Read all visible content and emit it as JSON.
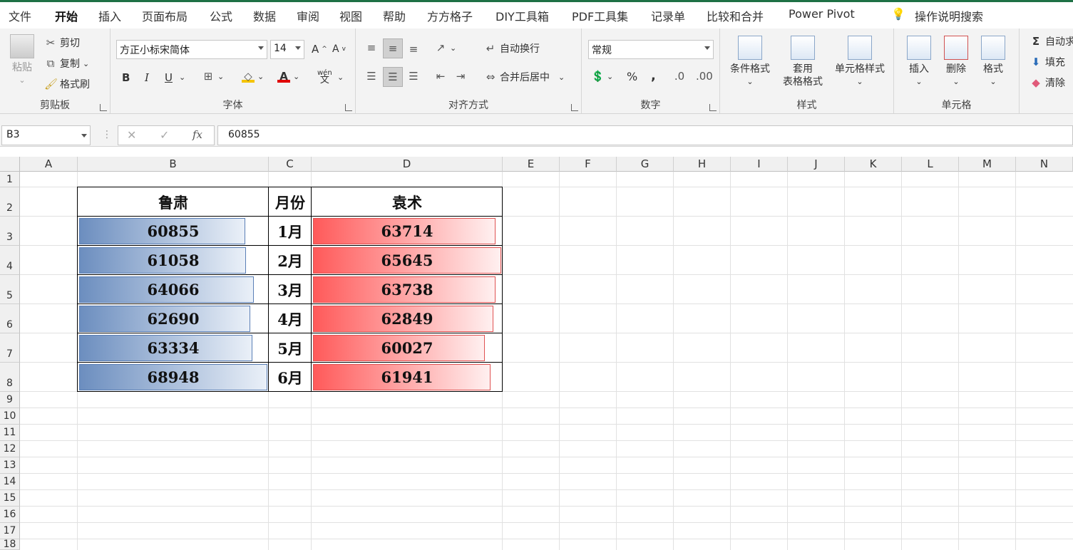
{
  "tabs": [
    "文件",
    "开始",
    "插入",
    "页面布局",
    "公式",
    "数据",
    "审阅",
    "视图",
    "帮助",
    "方方格子",
    "DIY工具箱",
    "PDF工具集",
    "记录单",
    "比较和合并",
    "Power Pivot"
  ],
  "active_tab": "开始",
  "search_placeholder": "操作说明搜索",
  "clipboard": {
    "paste": "粘贴",
    "cut": "剪切",
    "copy": "复制",
    "format_painter": "格式刷",
    "label": "剪贴板"
  },
  "font": {
    "name": "方正小标宋简体",
    "size": "14",
    "bold": "B",
    "italic": "I",
    "underline": "U",
    "label": "字体",
    "phonetic": "wén"
  },
  "alignment": {
    "wrap": "自动换行",
    "merge": "合并后居中",
    "label": "对齐方式"
  },
  "number": {
    "format": "常规",
    "percent": "%",
    "comma": ",",
    "label": "数字"
  },
  "styles": {
    "conditional": "条件格式",
    "table_line1": "套用",
    "table_line2": "表格格式",
    "cell_styles": "单元格样式",
    "label": "样式"
  },
  "cells": {
    "insert": "插入",
    "delete": "删除",
    "format": "格式",
    "label": "单元格"
  },
  "editing": {
    "autosum": "自动求",
    "fill": "填充",
    "clear": "清除"
  },
  "formula_bar": {
    "name_box": "B3",
    "formula": "60855",
    "fx": "fx"
  },
  "columns": [
    "A",
    "B",
    "C",
    "D",
    "E",
    "F",
    "G",
    "H",
    "I",
    "J",
    "K",
    "L",
    "M",
    "N"
  ],
  "rows": [
    "1",
    "2",
    "3",
    "4",
    "5",
    "6",
    "7",
    "8",
    "9",
    "10",
    "11",
    "12",
    "13",
    "14",
    "15",
    "16",
    "17",
    "18"
  ],
  "table": {
    "headers": [
      "鲁肃",
      "月份",
      "袁术"
    ],
    "rows": [
      {
        "b": "60855",
        "c": "1月",
        "d": "63714"
      },
      {
        "b": "61058",
        "c": "2月",
        "d": "65645"
      },
      {
        "b": "64066",
        "c": "3月",
        "d": "63738"
      },
      {
        "b": "62690",
        "c": "4月",
        "d": "62849"
      },
      {
        "b": "63334",
        "c": "5月",
        "d": "60027"
      },
      {
        "b": "68948",
        "c": "6月",
        "d": "61941"
      }
    ]
  },
  "colors": {
    "accent": "#1e7145",
    "bar_blue": "#6c8ebf",
    "bar_red": "#ff5a5a"
  }
}
